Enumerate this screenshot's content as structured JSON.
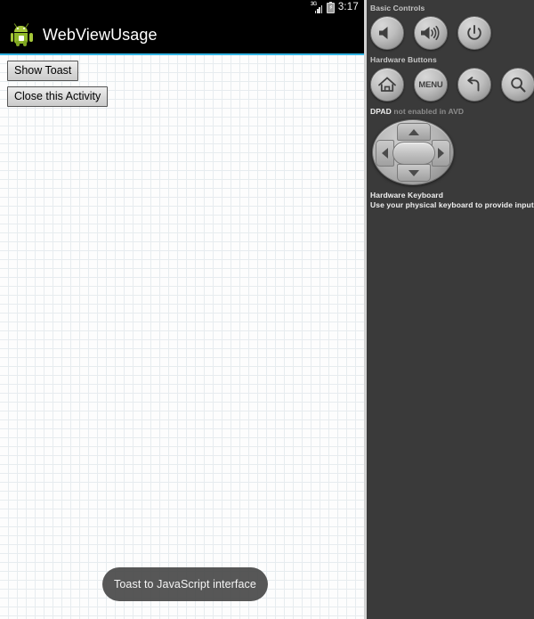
{
  "emulator": {
    "status_bar": {
      "network_label": "3G",
      "signal_icon": "signal-bars-icon",
      "battery_icon": "battery-charging-icon",
      "clock": "3:17"
    },
    "action_bar": {
      "app_icon": "android-robot-icon",
      "title": "WebViewUsage",
      "divider_color": "#33b5e5"
    },
    "webview": {
      "buttons": [
        {
          "label": "Show Toast",
          "name": "show-toast-button"
        },
        {
          "label": "Close this Activity",
          "name": "close-activity-button"
        }
      ],
      "toast": {
        "message": "Toast to JavaScript interface"
      }
    }
  },
  "control_panel": {
    "basic_controls": {
      "label": "Basic Controls",
      "buttons": [
        {
          "name": "volume-down-button",
          "icon": "volume-down-icon",
          "label": ""
        },
        {
          "name": "volume-up-button",
          "icon": "volume-up-icon",
          "label": ""
        },
        {
          "name": "power-button",
          "icon": "power-icon",
          "label": ""
        }
      ]
    },
    "hardware_buttons": {
      "label": "Hardware Buttons",
      "buttons": [
        {
          "name": "home-button",
          "icon": "home-icon",
          "label": ""
        },
        {
          "name": "menu-button",
          "icon": "menu-icon",
          "label": "MENU"
        },
        {
          "name": "back-button",
          "icon": "back-arrow-icon",
          "label": ""
        },
        {
          "name": "search-button",
          "icon": "search-icon",
          "label": ""
        }
      ]
    },
    "dpad": {
      "label_strong": "DPAD",
      "label_muted": " not enabled in AVD"
    },
    "hardware_keyboard": {
      "title": "Hardware Keyboard",
      "description": "Use your physical keyboard to provide input"
    }
  }
}
